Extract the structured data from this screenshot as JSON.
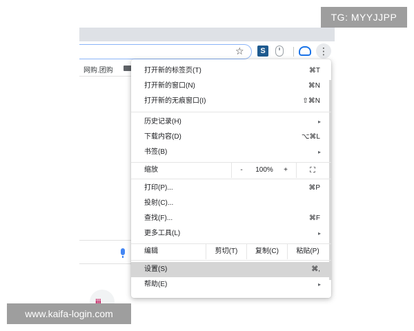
{
  "watermarks": {
    "top_right": "TG: MYYJJPP",
    "bottom_left": "www.kaifa-login.com"
  },
  "bookmarks_bar": {
    "item_label": "网购.团购"
  },
  "toolbar": {
    "ext_s_label": "S",
    "menu_glyph": "⋮",
    "star_glyph": "☆"
  },
  "menu": {
    "new_tab": {
      "label": "打开新的标签页(T)",
      "shortcut": "⌘T"
    },
    "new_window": {
      "label": "打开新的窗口(N)",
      "shortcut": "⌘N"
    },
    "new_incognito": {
      "label": "打开新的无痕窗口(I)",
      "shortcut": "⇧⌘N"
    },
    "history": {
      "label": "历史记录(H)",
      "arrow": "▸"
    },
    "downloads": {
      "label": "下载内容(D)",
      "shortcut": "⌥⌘L"
    },
    "bookmarks": {
      "label": "书签(B)",
      "arrow": "▸"
    },
    "zoom": {
      "label": "缩放",
      "minus": "-",
      "value": "100%",
      "plus": "+",
      "fullscreen": "⛶"
    },
    "print": {
      "label": "打印(P)...",
      "shortcut": "⌘P"
    },
    "cast": {
      "label": "投射(C)..."
    },
    "find": {
      "label": "查找(F)...",
      "shortcut": "⌘F"
    },
    "more_tools": {
      "label": "更多工具(L)",
      "arrow": "▸"
    },
    "edit": {
      "label": "编辑",
      "cut": "剪切(T)",
      "copy": "复制(C)",
      "paste": "粘贴(P)"
    },
    "settings": {
      "label": "设置(S)",
      "shortcut": "⌘,"
    },
    "help": {
      "label": "帮助(E)",
      "arrow": "▸"
    }
  },
  "colors": {
    "active_item_bg": "#d5d5d5",
    "watermark_bg": "#9e9e9e"
  }
}
